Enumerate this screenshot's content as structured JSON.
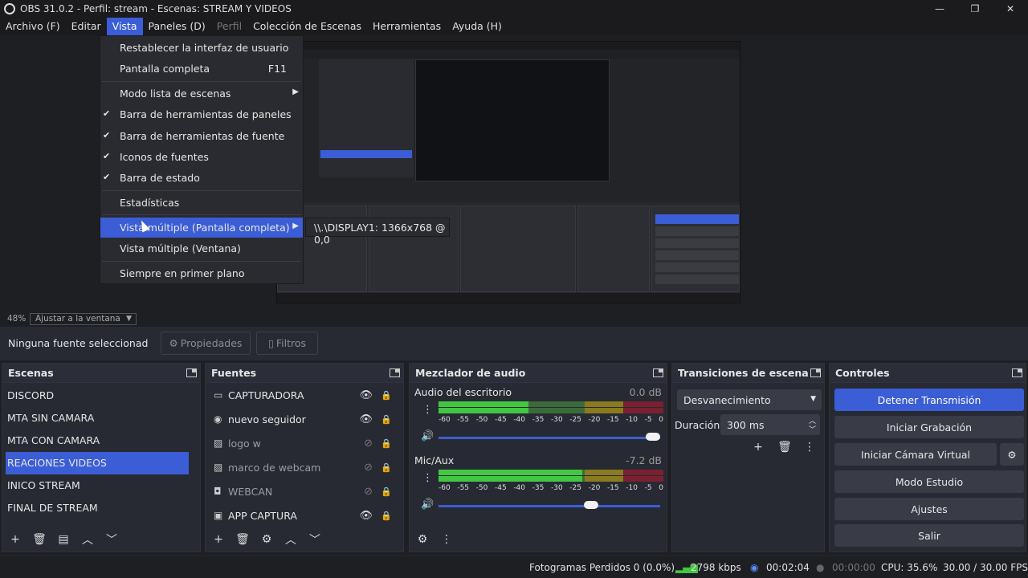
{
  "window": {
    "title": "OBS 31.0.2 - Perfil: stream - Escenas: STREAM Y VIDEOS",
    "min": "—",
    "max": "❐",
    "close": "✕"
  },
  "menubar": [
    "Archivo (F)",
    "Editar",
    "Vista",
    "Paneles (D)",
    "Perfil",
    "Colección de Escenas",
    "Herramientas",
    "Ayuda (H)"
  ],
  "vista_menu": {
    "reset_ui": "Restablecer la interfaz de usuario",
    "fullscreen": "Pantalla completa",
    "fullscreen_shortcut": "F11",
    "scene_list_mode": "Modo lista de escenas",
    "dock_toolbar": "Barra de herramientas de paneles",
    "source_toolbar": "Barra de herramientas de fuente",
    "source_icons": "Iconos de fuentes",
    "status_bar": "Barra de estado",
    "stats": "Estadísticas",
    "multiview_full": "Vista múltiple (Pantalla completa)",
    "multiview_window": "Vista múltiple (Ventana)",
    "always_on_top": "Siempre en primer plano",
    "submenu_display": "\\\\.\\DISPLAY1: 1366x768 @ 0,0"
  },
  "zoom": {
    "percent": "48%",
    "mode": "Ajustar a la ventana"
  },
  "source_toolbar": {
    "no_source": "Ninguna fuente seleccionad",
    "properties": "Propiedades",
    "filters": "Filtros"
  },
  "scenes": {
    "title": "Escenas",
    "items": [
      "DISCORD",
      "MTA SIN CAMARA",
      "MTA CON CAMARA",
      "REACIONES VIDEOS",
      "INICO STREAM",
      "FINAL DE STREAM"
    ]
  },
  "sources": {
    "title": "Fuentes",
    "items": [
      {
        "label": "CAPTURADORA",
        "icon": "monitor-icon"
      },
      {
        "label": "nuevo seguidor",
        "icon": "globe-icon"
      },
      {
        "label": "logo w",
        "icon": "image-icon"
      },
      {
        "label": "marco de webcam",
        "icon": "image-icon"
      },
      {
        "label": "WEBCAN",
        "icon": "camera-icon"
      },
      {
        "label": "APP CAPTURA",
        "icon": "window-icon"
      }
    ]
  },
  "mixer": {
    "title": "Mezclador de audio",
    "ch1": {
      "name": "Audio del escritorio",
      "db": "0.0 dB",
      "level": 0.4,
      "volume": 1.0
    },
    "ch2": {
      "name": "Mic/Aux",
      "db": "-7.2 dB",
      "level": 0.64,
      "volume": 0.7
    },
    "ticks": [
      "-60",
      "-55",
      "-50",
      "-45",
      "-40",
      "-35",
      "-30",
      "-25",
      "-20",
      "-15",
      "-10",
      "-5",
      "0"
    ]
  },
  "transitions": {
    "title": "Transiciones de escena",
    "selected": "Desvanecimiento",
    "duration_label": "Duración",
    "duration_value": "300 ms"
  },
  "controls": {
    "title": "Controles",
    "stop_stream": "Detener Transmisión",
    "start_recording": "Iniciar Grabación",
    "start_virtual_cam": "Iniciar Cámara Virtual",
    "studio_mode": "Modo Estudio",
    "settings": "Ajustes",
    "exit": "Salir"
  },
  "status": {
    "dropped": "Fotogramas Perdidos 0 (0.0%)",
    "bitrate": "2798 kbps",
    "stream_time": "00:02:04",
    "rec_time": "00:00:00",
    "cpu": "CPU: 35.6%",
    "fps": "30.00 / 30.00 FPS"
  },
  "colors": {
    "accent": "#3b5ed6",
    "panel": "#272a33",
    "bg": "#1e1f22"
  }
}
